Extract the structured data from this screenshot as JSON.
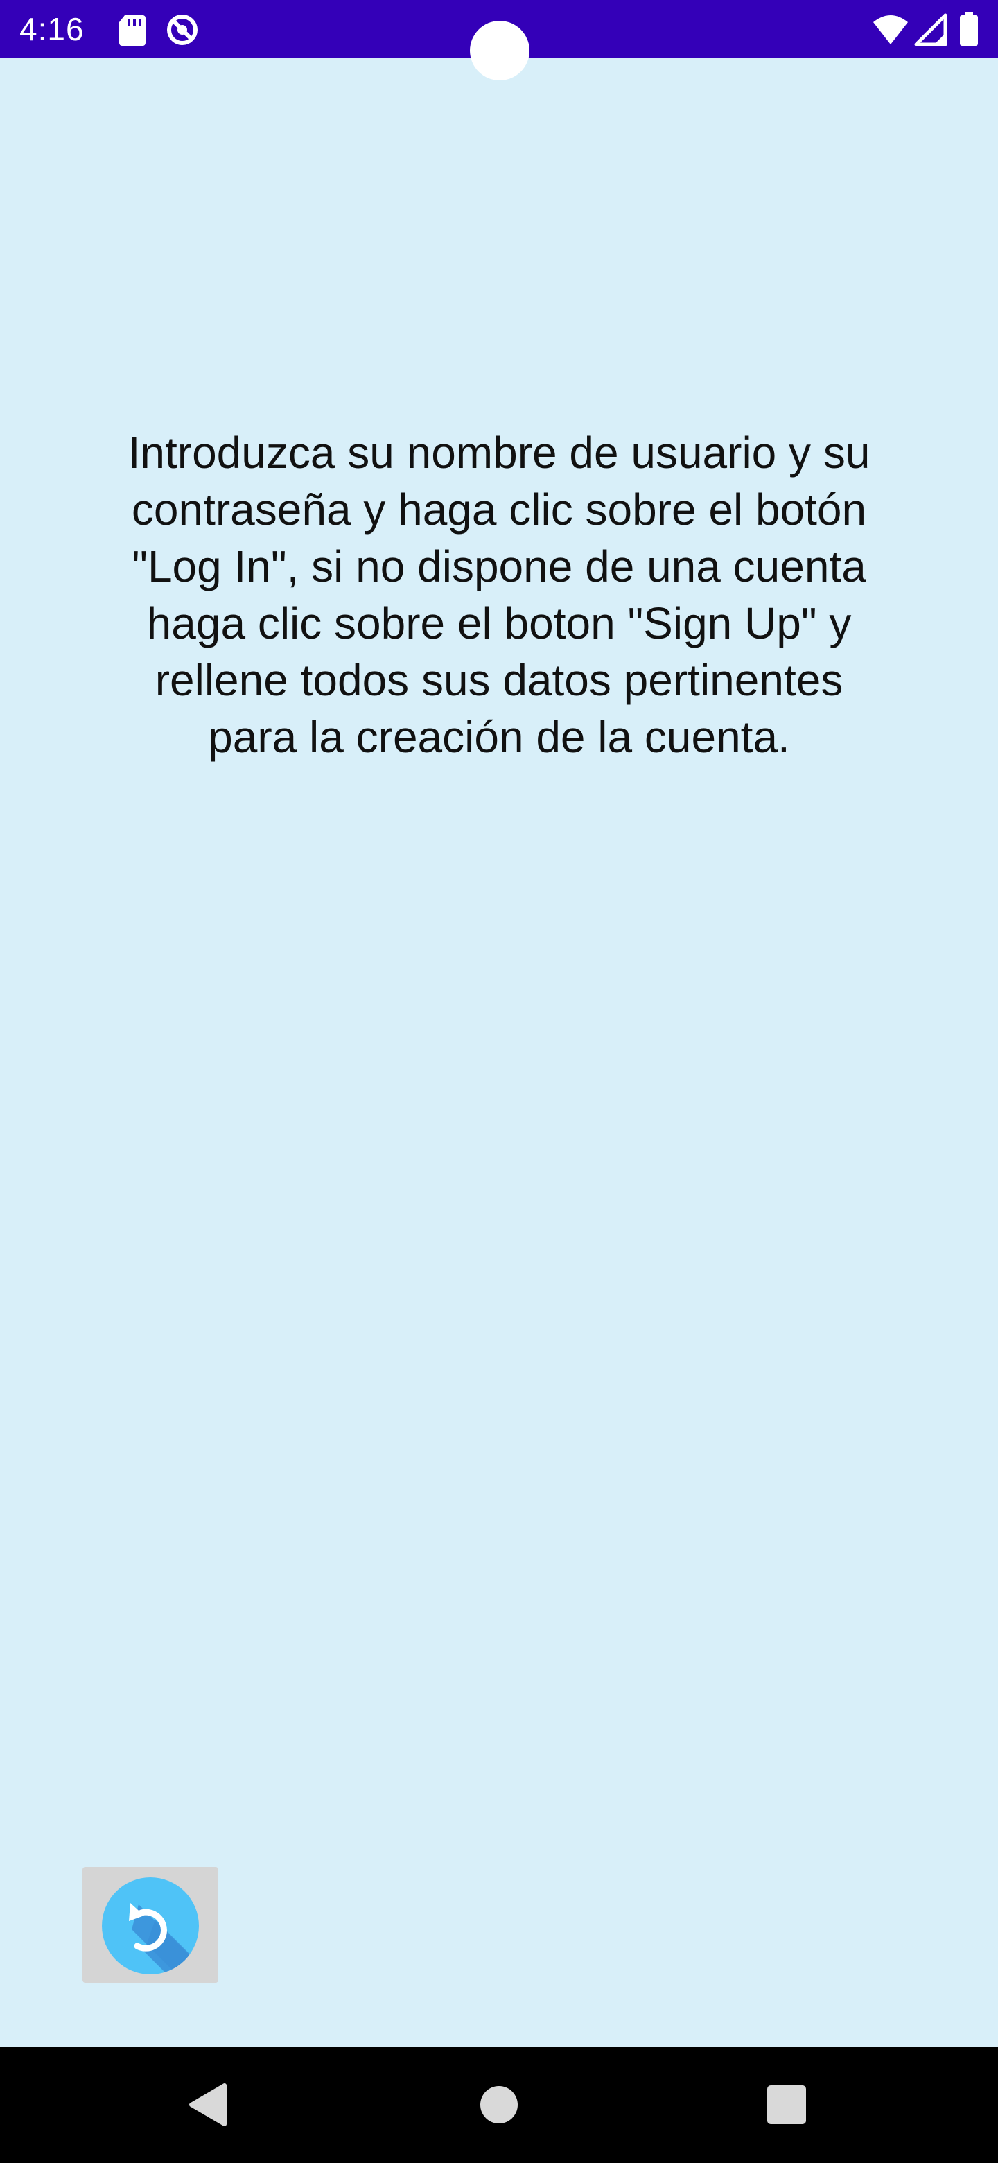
{
  "status_bar": {
    "time": "4:16",
    "background": "#3400b8",
    "icons": [
      "sd-card-icon",
      "no-data-saver-icon",
      "wifi-icon",
      "cell-signal-icon",
      "battery-icon"
    ]
  },
  "content": {
    "background": "#d8eff9",
    "instructions": "Introduzca su nombre de usuario y su contraseña y haga clic sobre el botón \"Log In\", si no dispone de una cuenta haga clic sobre el boton \"Sign Up\" y rellene todos sus datos pertinentes para la creación de la cuenta."
  },
  "back_button": {
    "icon": "undo-arrow-icon",
    "colors": {
      "circle": "#4fc3f7",
      "shadow": "#3a8fd8",
      "tile": "#d5d5d5"
    }
  },
  "nav_bar": {
    "buttons": [
      "back-triangle-icon",
      "home-circle-icon",
      "recents-square-icon"
    ]
  }
}
